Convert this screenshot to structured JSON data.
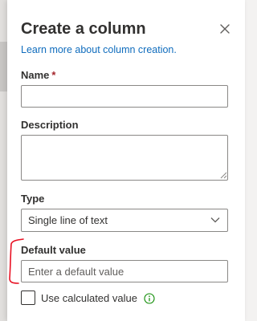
{
  "panel": {
    "title": "Create a column",
    "learn_more_link": "Learn more about column creation.",
    "close_icon": "close-icon"
  },
  "fields": {
    "name": {
      "label": "Name",
      "required_marker": "*",
      "value": ""
    },
    "description": {
      "label": "Description",
      "value": ""
    },
    "type": {
      "label": "Type",
      "selected": "Single line of text",
      "icon": "chevron-down-icon"
    },
    "default_value": {
      "label": "Default value",
      "placeholder": "Enter a default value",
      "value": ""
    },
    "calculated": {
      "label": "Use calculated value",
      "checked": false,
      "icon": "info-icon"
    }
  },
  "colors": {
    "link": "#0f6cbd",
    "required": "#a4262c",
    "annotation": "#e81123",
    "info_icon": "#0b8a00"
  }
}
